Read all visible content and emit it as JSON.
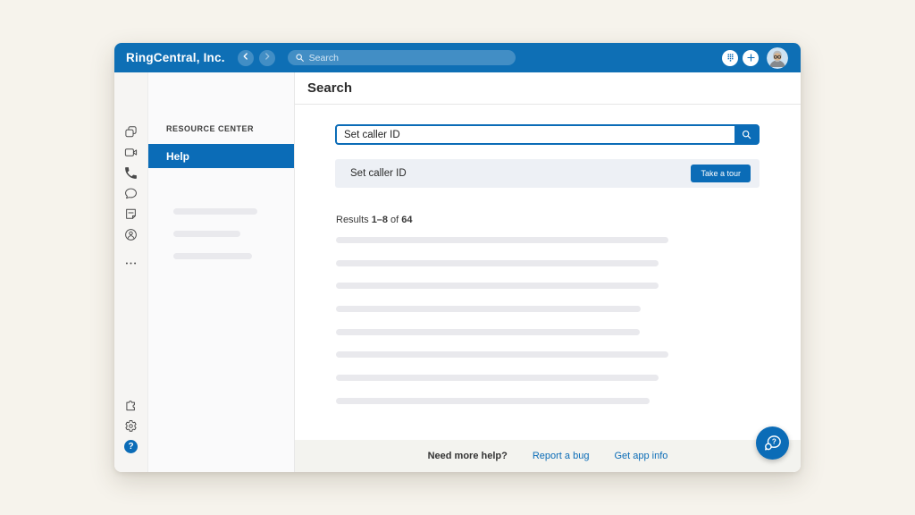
{
  "topbar": {
    "title": "RingCentral, Inc.",
    "search_placeholder": "Search",
    "icons": [
      "back-chevron",
      "forward-chevron",
      "search-magnifier",
      "dialpad",
      "plus",
      "user-avatar"
    ]
  },
  "rail": {
    "top_icons": [
      "message",
      "video-camera",
      "phone-handset",
      "speech-bubble",
      "fax-note",
      "contacts",
      "more-dots"
    ],
    "bottom_icons": [
      "puzzle",
      "gear",
      "help-question"
    ]
  },
  "resource_panel": {
    "header": "RESOURCE CENTER",
    "active_item": "Help",
    "skeleton_widths": [
      94,
      75,
      88
    ]
  },
  "main": {
    "title": "Search",
    "search": {
      "value": "Set caller ID",
      "submit_icon": "magnifier"
    },
    "result_card": {
      "title": "Set caller ID",
      "cta": "Take a tour"
    },
    "results_summary": {
      "label": "Results",
      "range": "1–8",
      "of": "of",
      "total": "64"
    },
    "skeleton_widths": [
      372,
      361,
      361,
      341,
      340,
      372,
      361,
      351
    ]
  },
  "footer": {
    "prompt": "Need more help?",
    "links": [
      "Report a bug",
      "Get app info"
    ]
  },
  "fab_icon": "chat-help",
  "colors": {
    "topbar_blue": "#0e6fb5",
    "accent_blue": "#0b6cb7",
    "card_bg": "#edf0f5",
    "skeleton_gray": "#e9e9ed",
    "footer_bg": "#f3f3ef",
    "page_bg": "#f6f3ec"
  }
}
